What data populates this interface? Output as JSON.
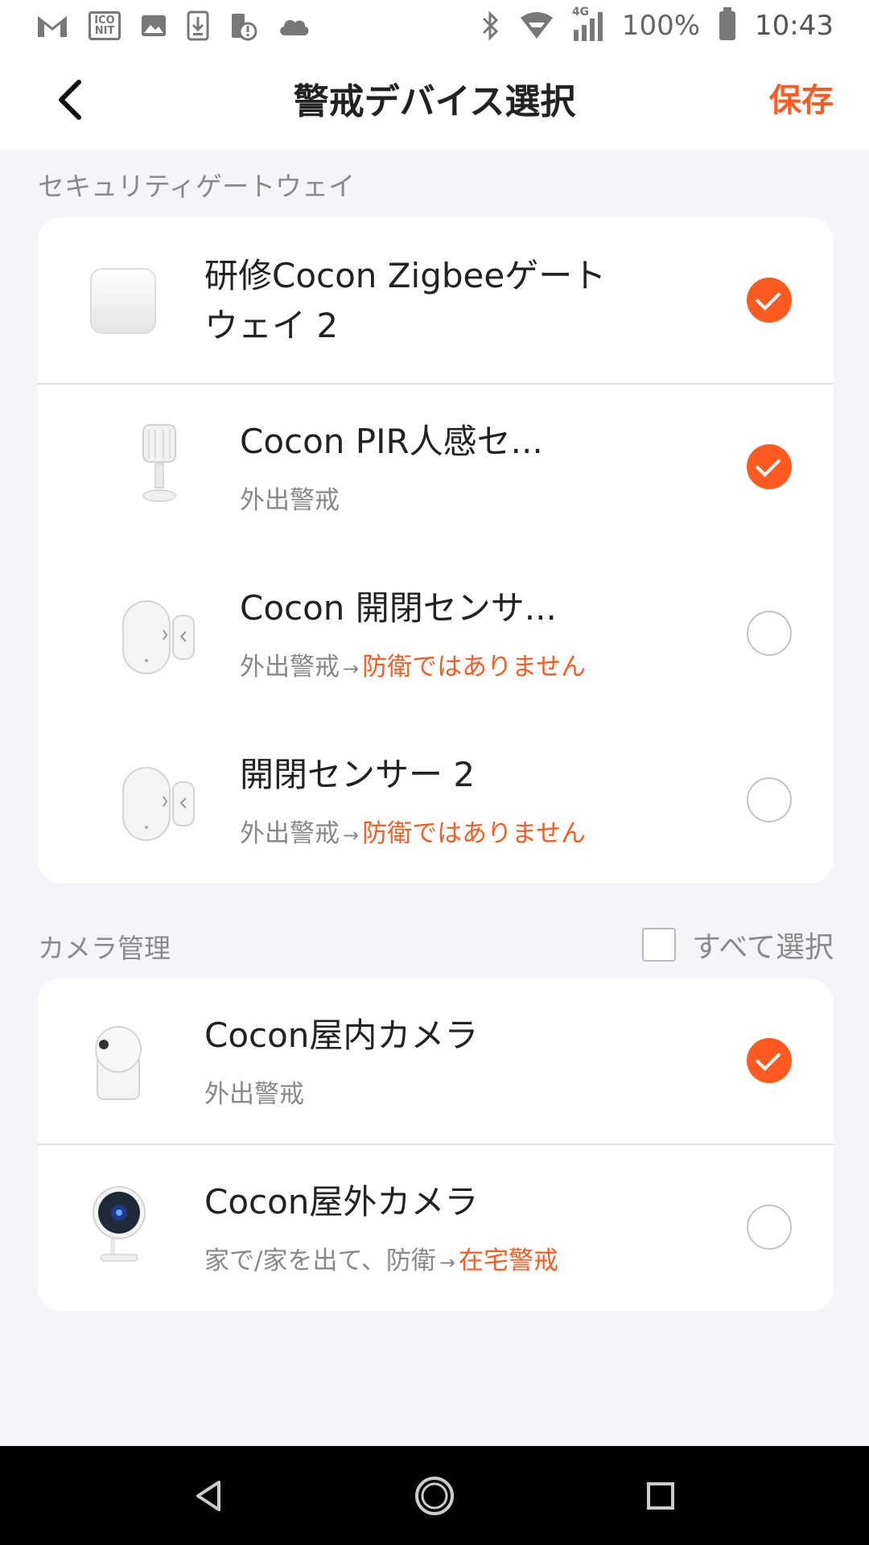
{
  "statusbar": {
    "network": "4G",
    "battery": "100%",
    "time": "10:43",
    "left_icons": [
      "gmail-icon",
      "iconit-icon",
      "gallery-icon",
      "download-icon",
      "battery-alert-icon",
      "cloud-icon"
    ],
    "right_icons": [
      "bluetooth-icon",
      "wifi-icon",
      "signal-icon",
      "battery-icon"
    ],
    "iconit_label": "ICO NIT"
  },
  "header": {
    "title": "警戒デバイス選択",
    "save_label": "保存",
    "back_icon": "chevron-left-icon"
  },
  "gateway_section": {
    "label": "セキュリティゲートウェイ",
    "gateway": {
      "name_line1": "研修Cocon Zigbeeゲート",
      "name_line2": "ウェイ 2",
      "checked": true,
      "icon": "gateway-device-icon"
    },
    "devices": [
      {
        "name": "Cocon PIR人感セ...",
        "mode": "外出警戒",
        "status": "",
        "checked": true,
        "icon": "pir-sensor-icon"
      },
      {
        "name": "Cocon 開閉センサ...",
        "mode": "外出警戒",
        "status": "防衛ではありません",
        "checked": false,
        "icon": "door-sensor-icon"
      },
      {
        "name": "開閉センサー 2",
        "mode": "外出警戒",
        "status": "防衛ではありません",
        "checked": false,
        "icon": "door-sensor-icon"
      }
    ]
  },
  "camera_section": {
    "label": "カメラ管理",
    "select_all_label": "すべて選択",
    "select_all_checked": false,
    "cameras": [
      {
        "name": "Cocon屋内カメラ",
        "mode": "外出警戒",
        "status": "",
        "checked": true,
        "icon": "indoor-camera-icon"
      },
      {
        "name": "Cocon屋外カメラ",
        "mode": "家で/家を出て、防衛",
        "status": "在宅警戒",
        "checked": false,
        "icon": "outdoor-camera-icon"
      }
    ]
  },
  "sysnav": {
    "icons": [
      "back-triangle-icon",
      "home-circle-icon",
      "recents-square-icon"
    ]
  },
  "colors": {
    "accent": "#ff5a1f",
    "background": "#f4f5f9",
    "card": "#ffffff",
    "secondary_text": "#888888"
  }
}
